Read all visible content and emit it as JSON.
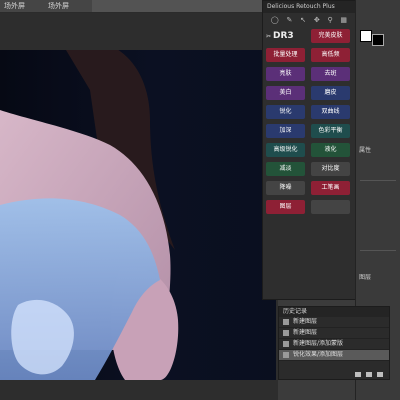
{
  "tabs": [
    {
      "label": "场外屏"
    },
    {
      "label": "场外屏"
    }
  ],
  "panel": {
    "title": "Delicious Retouch Plus",
    "logo": "DR3",
    "buttons": [
      {
        "label": "完美皮肤",
        "color": "red"
      },
      {
        "label": "批量处理",
        "color": "red"
      },
      {
        "label": "高低频",
        "color": "red"
      },
      {
        "label": "亮肤",
        "color": "purple"
      },
      {
        "label": "去斑",
        "color": "purple"
      },
      {
        "label": "美白",
        "color": "purple"
      },
      {
        "label": "磨皮",
        "color": "blue"
      },
      {
        "label": "锐化",
        "color": "blue"
      },
      {
        "label": "双曲线",
        "color": "blue"
      },
      {
        "label": "加深",
        "color": "blue"
      },
      {
        "label": "色彩平衡",
        "color": "teal"
      },
      {
        "label": "高级锐化",
        "color": "teal"
      },
      {
        "label": "液化",
        "color": "green"
      },
      {
        "label": "减淡",
        "color": "green"
      },
      {
        "label": "对比度",
        "color": "grey"
      },
      {
        "label": "降噪",
        "color": "grey"
      },
      {
        "label": "工笔画",
        "color": "red"
      },
      {
        "label": "图层",
        "color": "red"
      }
    ]
  },
  "right": {
    "properties_label": "属性",
    "layers_label": "图层"
  },
  "history": {
    "title": "历史记录",
    "items": [
      {
        "label": "新建图层"
      },
      {
        "label": "新建图层"
      },
      {
        "label": "新建图层/添加蒙版"
      },
      {
        "label": "锐化效果/添加图层",
        "active": true
      }
    ]
  }
}
